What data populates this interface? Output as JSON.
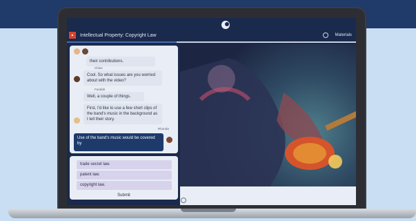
{
  "app": {
    "title": "Intellectual Property: Copyright Law",
    "menu_materials": "Materials",
    "progress_fraction": 0.38
  },
  "chat": {
    "messages": [
      {
        "speaker": "",
        "text": "their contributions."
      },
      {
        "speaker": "Chloe",
        "text": "Cool. So what issues are you worried about with the video?"
      },
      {
        "speaker": "Faridah",
        "text": "Well, a couple of things."
      },
      {
        "speaker": "",
        "text": "First, I'd like to use a few short clips of the band's music in the background as I tell their story."
      }
    ],
    "user_name": "Rhonda",
    "user_message": "Use of the band's music would be covered by"
  },
  "answers": {
    "options": [
      "trade secret law.",
      "patent law.",
      "copyright law."
    ],
    "submit_label": "Submit"
  },
  "colors": {
    "brand": "#d6452f",
    "navy": "#1d3a6b",
    "option_bg": "#d8d3ec"
  }
}
